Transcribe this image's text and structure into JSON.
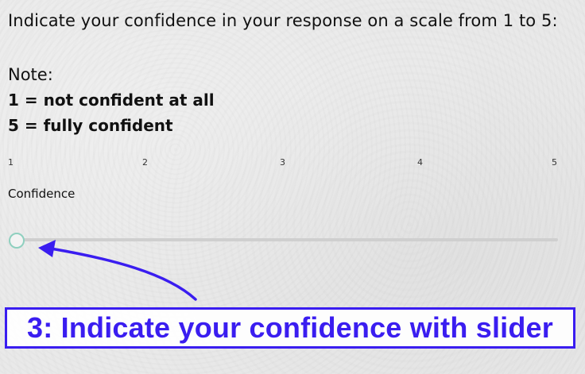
{
  "question": "Indicate your confidence in your response on a scale from 1 to 5:",
  "note": {
    "label": "Note:",
    "line1": "1 = not confident at all",
    "line2": "5 = fully confident"
  },
  "slider": {
    "ticks": [
      "1",
      "2",
      "3",
      "4",
      "5"
    ],
    "label": "Confidence",
    "value": null
  },
  "annotation": {
    "text": "3: Indicate your confidence with slider"
  },
  "colors": {
    "accent": "#3a1df0",
    "thumb_border": "#8fd0bf",
    "track": "#cfcfcf"
  }
}
